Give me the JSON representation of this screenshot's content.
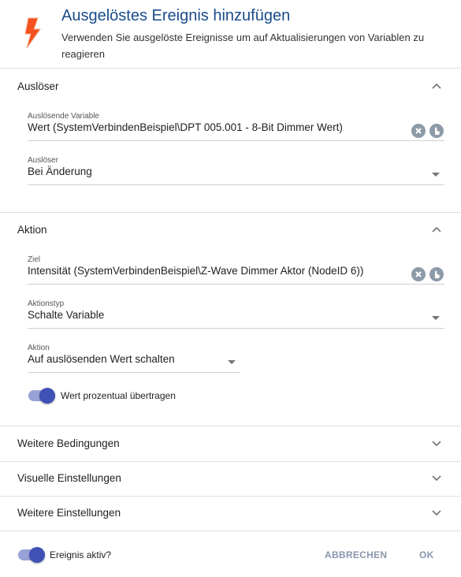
{
  "header": {
    "title": "Ausgelöstes Ereignis hinzufügen",
    "subtitle": "Verwenden Sie ausgelöste Ereignisse um auf Aktualisierungen von Variablen zu reagieren",
    "icon": "lightning-bolt-icon",
    "accent_color": "#f4511e",
    "title_color": "#1a4c8b"
  },
  "trigger_section": {
    "title": "Auslöser",
    "variable_label": "Auslösende Variable",
    "variable_value": "Wert (SystemVerbindenBeispiel\\DPT 005.001 - 8-Bit Dimmer Wert)",
    "trigger_label": "Auslöser",
    "trigger_value": "Bei Änderung"
  },
  "action_section": {
    "title": "Aktion",
    "target_label": "Ziel",
    "target_value": "Intensität (SystemVerbindenBeispiel\\Z-Wave Dimmer Aktor (NodeID 6))",
    "action_type_label": "Aktionstyp",
    "action_type_value": "Schalte Variable",
    "action_label": "Aktion",
    "action_value": "Auf auslösenden Wert schalten",
    "percent_toggle_label": "Wert prozentual übertragen",
    "percent_toggle_on": true
  },
  "collapsed_sections": [
    {
      "title": "Weitere Bedingungen"
    },
    {
      "title": "Visuelle Einstellungen"
    },
    {
      "title": "Weitere Einstellungen"
    }
  ],
  "footer": {
    "active_toggle_label": "Ereignis aktiv?",
    "active_toggle_on": true,
    "cancel_label": "ABBRECHEN",
    "ok_label": "OK",
    "toggle_color": "#3f51b5"
  }
}
